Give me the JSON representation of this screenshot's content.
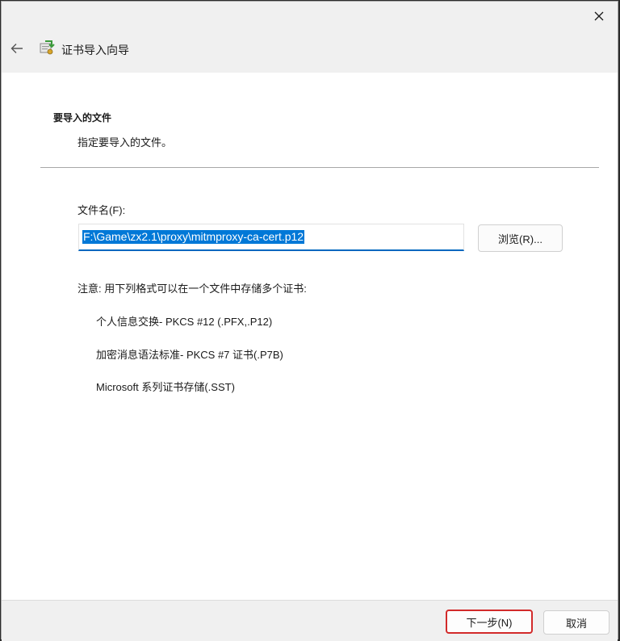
{
  "window": {
    "title": "证书导入向导",
    "icons": {
      "close": "close-icon",
      "back": "back-arrow-icon",
      "wizard": "certificate-wizard-icon"
    }
  },
  "page": {
    "heading": "要导入的文件",
    "description": "指定要导入的文件。"
  },
  "file_field": {
    "label": "文件名(F):",
    "value": "F:\\Game\\zx2.1\\proxy\\mitmproxy-ca-cert.p12",
    "browse_label": "浏览(R)..."
  },
  "note": {
    "text": "注意: 用下列格式可以在一个文件中存储多个证书:",
    "formats": [
      "个人信息交换- PKCS #12 (.PFX,.P12)",
      "加密消息语法标准- PKCS #7 证书(.P7B)",
      "Microsoft 系列证书存储(.SST)"
    ]
  },
  "footer": {
    "next_label": "下一步(N)",
    "cancel_label": "取消"
  },
  "colors": {
    "accent": "#0067c0",
    "selection": "#0078d7",
    "highlight_border": "#d22a2a"
  }
}
